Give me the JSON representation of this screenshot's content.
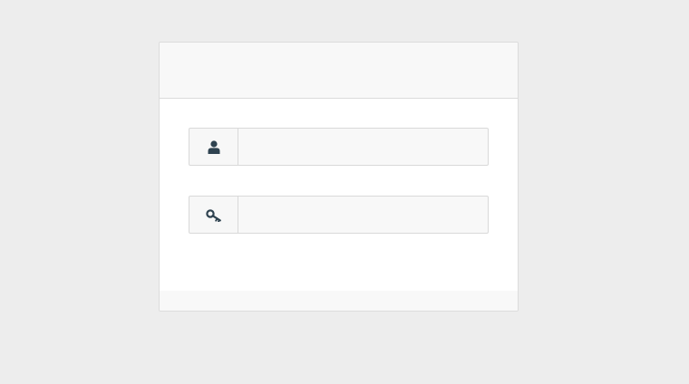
{
  "login": {
    "username": {
      "icon": "user-icon",
      "value": "",
      "placeholder": ""
    },
    "password": {
      "icon": "key-icon",
      "value": "",
      "placeholder": ""
    }
  },
  "colors": {
    "background": "#ededed",
    "panel": "#ffffff",
    "header": "#f8f8f8",
    "border": "#dcdcdc",
    "icon": "#2f4350"
  }
}
